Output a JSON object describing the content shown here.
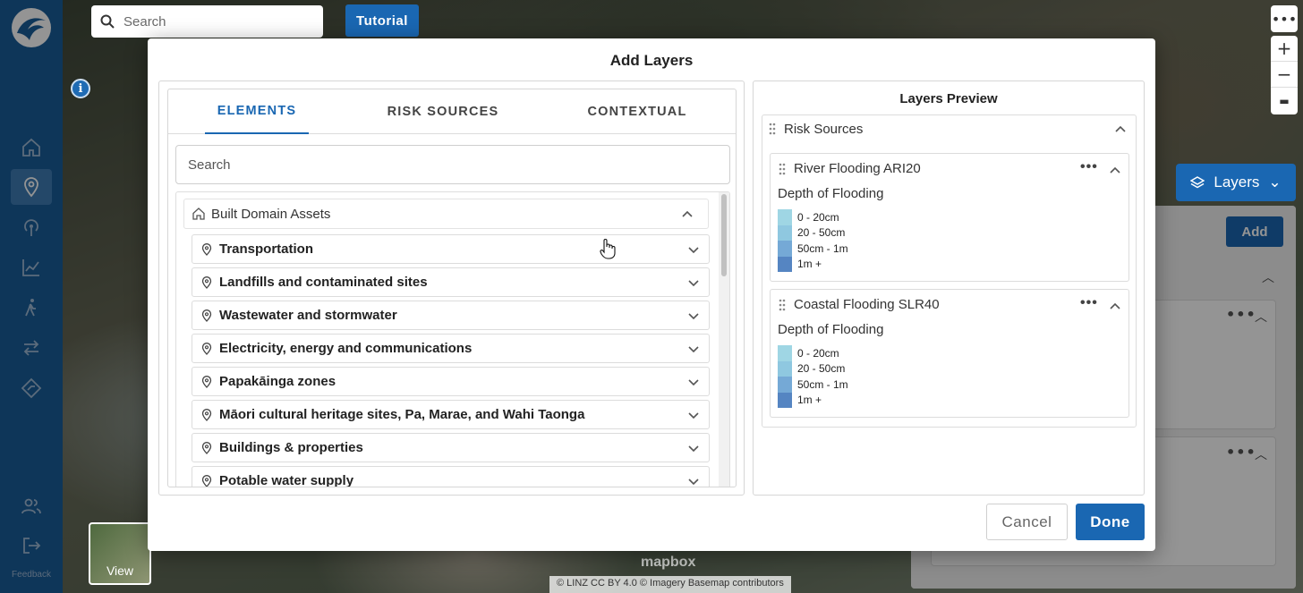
{
  "map": {
    "search_placeholder": "Search",
    "tutorial_label": "Tutorial",
    "info_label": "i",
    "more_label": "•••",
    "zoom_in_label": "+",
    "zoom_out_label": "−",
    "layers_label": "Layers",
    "layers_add_label": "Add",
    "view_label": "View",
    "mapbox_label": "mapbox",
    "attribution": "© LINZ CC BY 4.0 © Imagery Basemap contributors"
  },
  "rail": {
    "items": [
      "home-icon",
      "map-pin-icon",
      "broadcast-icon",
      "chart-icon",
      "walking-icon",
      "swap-icon",
      "compass-icon"
    ],
    "active_index": 1,
    "users_icon": "users-icon",
    "logout_icon": "logout-icon",
    "feedback_label": "Feedback"
  },
  "modal": {
    "title": "Add Layers",
    "tabs": [
      {
        "label": "ELEMENTS",
        "active": true
      },
      {
        "label": "RISK SOURCES",
        "active": false
      },
      {
        "label": "CONTEXTUAL",
        "active": false
      }
    ],
    "search_placeholder": "Search",
    "group": {
      "label": "Built Domain Assets",
      "items": [
        "Transportation",
        "Landfills and contaminated sites",
        "Wastewater and stormwater",
        "Electricity, energy and communications",
        "Papakāinga zones",
        "Māori cultural heritage sites, Pa, Marae, and Wahi Taonga",
        "Buildings & properties",
        "Potable water supply"
      ]
    },
    "preview": {
      "title": "Layers Preview",
      "section_label": "Risk Sources",
      "layers": [
        {
          "name": "River Flooding ARI20",
          "legend_title": "Depth of Flooding",
          "legend": [
            "0 - 20cm",
            "20 - 50cm",
            "50cm - 1m",
            "1m +"
          ]
        },
        {
          "name": "Coastal Flooding SLR40",
          "legend_title": "Depth of Flooding",
          "legend": [
            "0 - 20cm",
            "20 - 50cm",
            "50cm - 1m",
            "1m +"
          ]
        }
      ],
      "more_label": "•••"
    },
    "cancel_label": "Cancel",
    "done_label": "Done"
  },
  "colors": {
    "rail": "#195d9a",
    "accent": "#1a67b2",
    "legend": [
      "#9fd6e4",
      "#8fc8e0",
      "#75a9d6",
      "#5585c2"
    ]
  }
}
